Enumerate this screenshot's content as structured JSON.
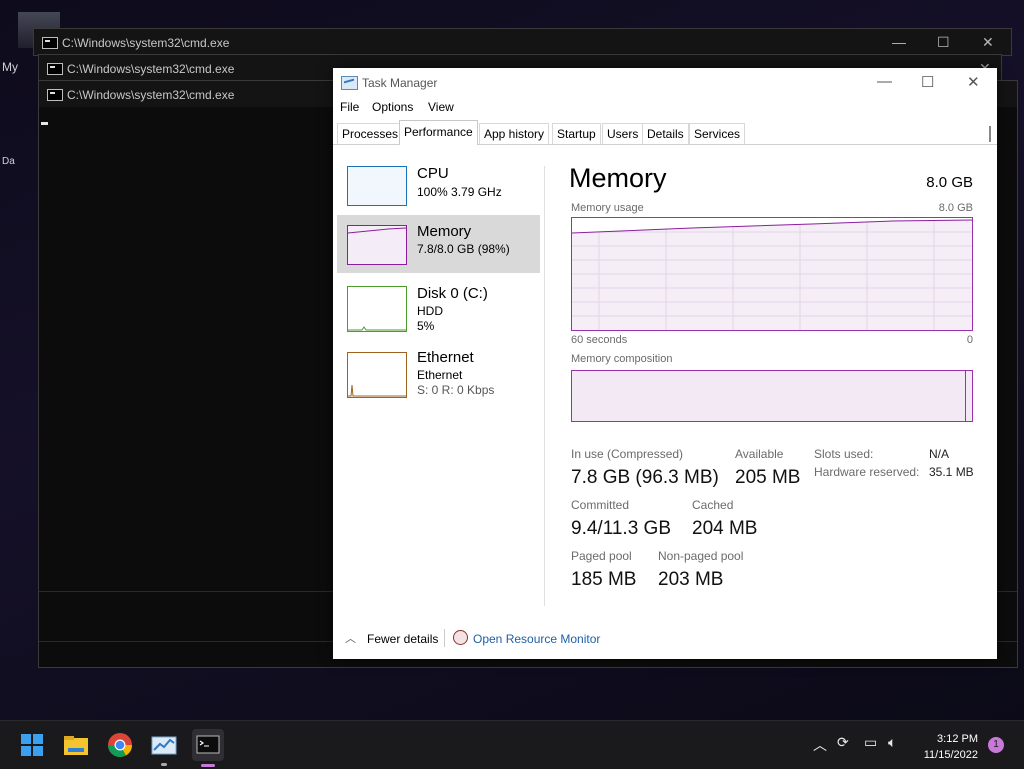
{
  "desktop": {
    "label_1": "My",
    "label_2": "Da"
  },
  "cmd_windows": [
    {
      "title": "C:\\Windows\\system32\\cmd.exe"
    },
    {
      "title": "C:\\Windows\\system32\\cmd.exe"
    },
    {
      "title": "C:\\Windows\\system32\\cmd.exe"
    }
  ],
  "window_controls": {
    "minimize": "—",
    "maximize": "☐",
    "close": "✕"
  },
  "task_manager": {
    "title": "Task Manager",
    "menu": [
      "File",
      "Options",
      "View"
    ],
    "tabs": [
      "Processes",
      "Performance",
      "App history",
      "Startup",
      "Users",
      "Details",
      "Services"
    ],
    "active_tab": "Performance",
    "sidebar": [
      {
        "name": "CPU",
        "sub1": "100%  3.79 GHz",
        "sub2": "",
        "color": "#1a73b8"
      },
      {
        "name": "Memory",
        "sub1": "7.8/8.0 GB (98%)",
        "sub2": "",
        "color": "#8b1e9e"
      },
      {
        "name": "Disk 0 (C:)",
        "sub1": "HDD",
        "sub2": "5%",
        "color": "#4b9c2a"
      },
      {
        "name": "Ethernet",
        "sub1": "Ethernet",
        "sub2": "S: 0  R: 0 Kbps",
        "color": "#a0611d"
      }
    ],
    "panel": {
      "title": "Memory",
      "total": "8.0 GB",
      "usage_label": "Memory usage",
      "usage_max": "8.0 GB",
      "time_left": "60 seconds",
      "time_right": "0",
      "composition_label": "Memory composition",
      "stats": {
        "in_use_label": "In use (Compressed)",
        "in_use_value": "7.8 GB (96.3 MB)",
        "available_label": "Available",
        "available_value": "205 MB",
        "committed_label": "Committed",
        "committed_value": "9.4/11.3 GB",
        "cached_label": "Cached",
        "cached_value": "204 MB",
        "paged_label": "Paged pool",
        "paged_value": "185 MB",
        "nonpaged_label": "Non-paged pool",
        "nonpaged_value": "203 MB",
        "slots_label": "Slots used:",
        "slots_value": "N/A",
        "hw_label": "Hardware reserved:",
        "hw_value": "35.1 MB"
      }
    },
    "footer": {
      "fewer": "Fewer details",
      "resmon": "Open Resource Monitor"
    }
  },
  "taskbar": {
    "apps": [
      "start-icon",
      "file-explorer-icon",
      "chrome-icon",
      "task-manager-icon",
      "terminal-icon"
    ],
    "time": "3:12 PM",
    "date": "11/15/2022",
    "notification_count": "1"
  }
}
